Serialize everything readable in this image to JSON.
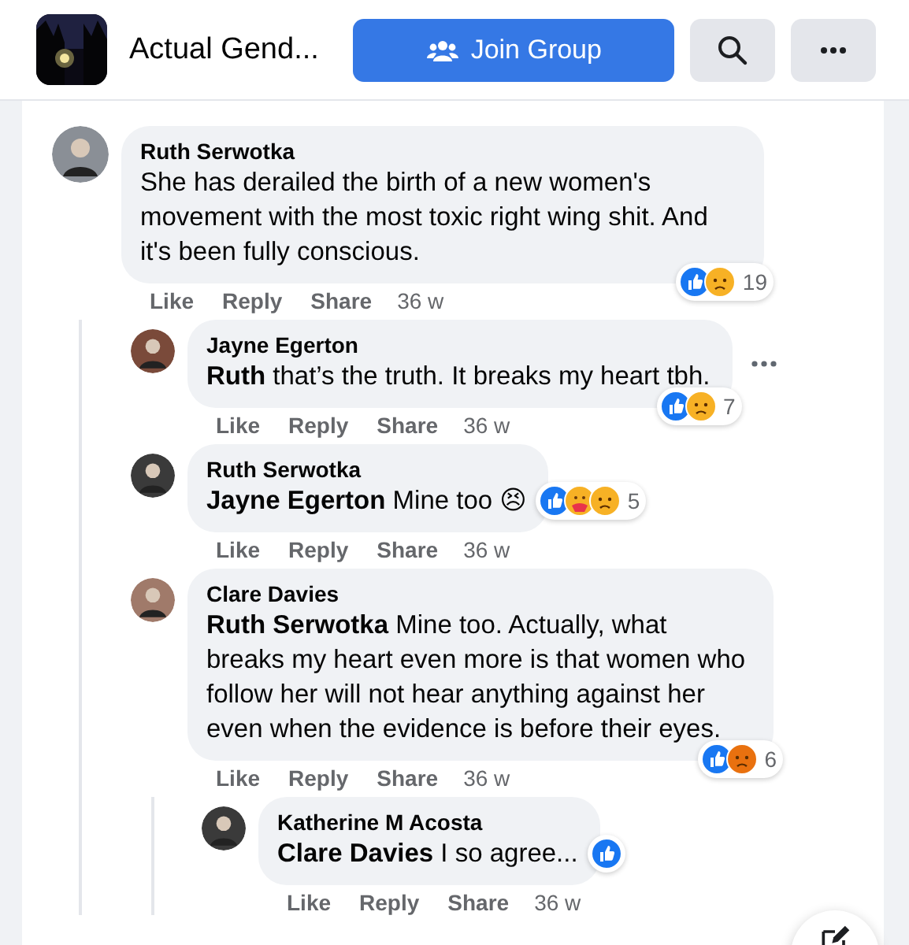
{
  "header": {
    "group_name": "Actual Gend...",
    "join_button": "Join Group"
  },
  "comments": [
    {
      "author": "Ruth Serwotka",
      "text": "She has derailed the birth of a new women's movement with the most toxic right wing shit. And it's been fully conscious.",
      "reactions": [
        {
          "kind": "like"
        },
        {
          "kind": "sad"
        }
      ],
      "reaction_count": "19",
      "actions": [
        "Like",
        "Reply",
        "Share"
      ],
      "time": "36 w",
      "children": [
        {
          "author": "Jayne Egerton",
          "text": "**Ruth** that’s the truth. It breaks my heart tbh.",
          "reactions": [
            {
              "kind": "like"
            },
            {
              "kind": "sad"
            }
          ],
          "reaction_count": "7",
          "actions": [
            "Like",
            "Reply",
            "Share"
          ],
          "time": "36 w",
          "more_button": true
        },
        {
          "author": "Ruth Serwotka",
          "text": "**Jayne Egerton** Mine too 😣",
          "reactions": [
            {
              "kind": "like"
            },
            {
              "kind": "care"
            },
            {
              "kind": "sad"
            }
          ],
          "reaction_count": "5",
          "actions": [
            "Like",
            "Reply",
            "Share"
          ],
          "time": "36 w"
        },
        {
          "author": "Clare Davies",
          "text": "**Ruth Serwotka** Mine too. Actually, what breaks my heart even more is that women who follow her will not hear anything against her even when the evidence is before their eyes.",
          "reactions": [
            {
              "kind": "like"
            },
            {
              "kind": "angry"
            }
          ],
          "reaction_count": "6",
          "actions": [
            "Like",
            "Reply",
            "Share"
          ],
          "time": "36 w",
          "children": [
            {
              "author": "Katherine M Acosta",
              "text": "**Clare Davies** I so agree...",
              "reactions": [
                {
                  "kind": "like"
                }
              ],
              "actions": [
                "Like",
                "Reply",
                "Share"
              ],
              "time": "36 w"
            }
          ]
        }
      ]
    }
  ]
}
